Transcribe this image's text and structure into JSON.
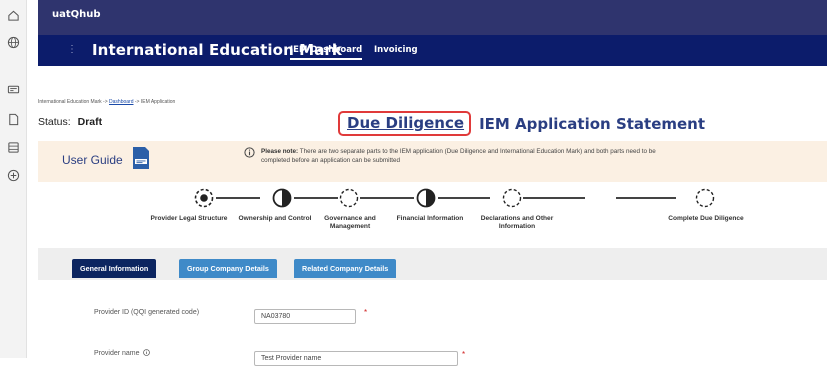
{
  "rail": {
    "icons": [
      "home-icon",
      "globe-icon",
      "card-icon",
      "document-icon",
      "database-icon",
      "add-circle-icon"
    ]
  },
  "topbar": {
    "hub_name": "uatQhub"
  },
  "navbar": {
    "app_title": "International Education Mark",
    "links": [
      {
        "label": "IEM Dashboard",
        "active": true
      },
      {
        "label": "Invoicing",
        "active": false
      }
    ]
  },
  "breadcrumb": {
    "root": "International Education Mark ->",
    "dashboard": "Dashboard",
    "current": "-> IEM Application"
  },
  "status": {
    "label": "Status:",
    "value": "Draft"
  },
  "title": {
    "due_diligence": "Due Diligence",
    "statement": "IEM Application Statement"
  },
  "guide": {
    "label": "User Guide"
  },
  "note": {
    "prefix": "Please note:",
    "text": "There are two separate parts to the IEM application (Due Diligence and International Education Mark) and both parts need to be completed before an application can be submitted"
  },
  "steps": [
    {
      "label": "Provider Legal Structure",
      "state": "current"
    },
    {
      "label": "Ownership and Control",
      "state": "partial"
    },
    {
      "label": "Governance and Management",
      "state": "empty"
    },
    {
      "label": "Financial Information",
      "state": "partial"
    },
    {
      "label": "Declarations and Other Information",
      "state": "empty"
    },
    {
      "label": "Complete Due Diligence",
      "state": "empty"
    }
  ],
  "tabs": [
    {
      "label": "General Information",
      "active": true
    },
    {
      "label": "Group Company Details",
      "active": false
    },
    {
      "label": "Related Company Details",
      "active": false
    }
  ],
  "form": {
    "provider_id": {
      "label": "Provider ID (QQI generated code)",
      "value": "NA03780",
      "required_mark": "*"
    },
    "provider_name": {
      "label": "Provider name",
      "value": "Test Provider name",
      "required_mark": "*"
    }
  },
  "colors": {
    "topbar": "#2f346e",
    "navbar": "#0c1c6b",
    "title": "#2a3e82",
    "highlight": "#e03a3a",
    "note_bg": "#fbf0e3",
    "tab_active": "#0c2560",
    "tab_inactive": "#3f8ac8"
  }
}
